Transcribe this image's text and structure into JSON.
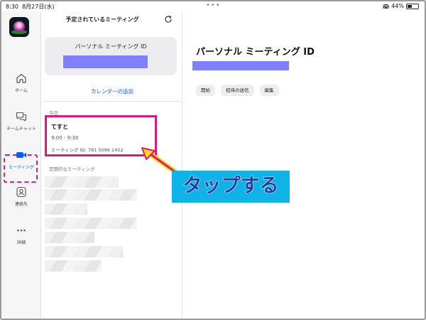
{
  "status_bar": {
    "time": "8:30",
    "date": "8月27日(水)",
    "center_dots": "•••",
    "battery_text": "44%",
    "battery_level": 0.44
  },
  "nav": {
    "app_icon": "lotus-app-icon",
    "items": [
      {
        "label": "ホーム",
        "icon": "home-icon"
      },
      {
        "label": "チームチャット",
        "icon": "chat-icon"
      },
      {
        "label": "ミーティング",
        "icon": "video-camera-icon",
        "active": true
      },
      {
        "label": "連絡先",
        "icon": "contact-icon"
      },
      {
        "label": "詳細",
        "icon": "more-icon"
      }
    ],
    "active_color": "#0b5cff"
  },
  "list": {
    "title": "予定されているミーティング",
    "refresh_icon": "refresh-icon",
    "pmi_label": "パーソナル ミーティング ID",
    "add_calendar": "カレンダーの追加",
    "today_label": "今日",
    "meeting": {
      "title": "てすと",
      "time": "9:00 - 9:30",
      "id_line": "ミーティング ID: 781 5096 1452"
    },
    "recurring_label": "定期的なミーティング"
  },
  "detail": {
    "title": "パーソナル ミーティング ID",
    "buttons": [
      "開始",
      "招待の送信",
      "編集"
    ]
  },
  "annotation": {
    "text": "タップする",
    "highlight_color": "#e0197d",
    "callout_color": "#10b3e8"
  }
}
